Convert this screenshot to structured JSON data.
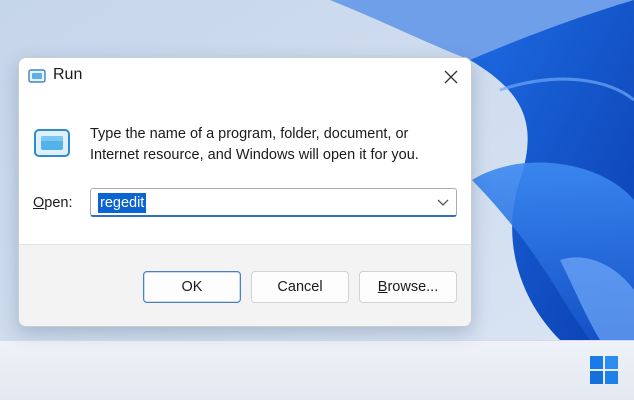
{
  "dialog": {
    "title": "Run",
    "description_line1": "Type the name of a program, folder, document, or",
    "description_line2": "Internet resource, and Windows will open it for you.",
    "open_label_mnemonic": "O",
    "open_label_rest": "pen:",
    "open_value": "regedit",
    "buttons": {
      "ok": "OK",
      "cancel": "Cancel",
      "browse_mnemonic": "B",
      "browse_rest": "rowse..."
    }
  },
  "icons": {
    "title": "run-icon",
    "close": "close-icon",
    "dropdown": "chevron-down-icon",
    "start": "windows-logo-icon"
  },
  "colors": {
    "accent": "#0a64d2",
    "wallpaper_blue": "#1a5fd8"
  }
}
